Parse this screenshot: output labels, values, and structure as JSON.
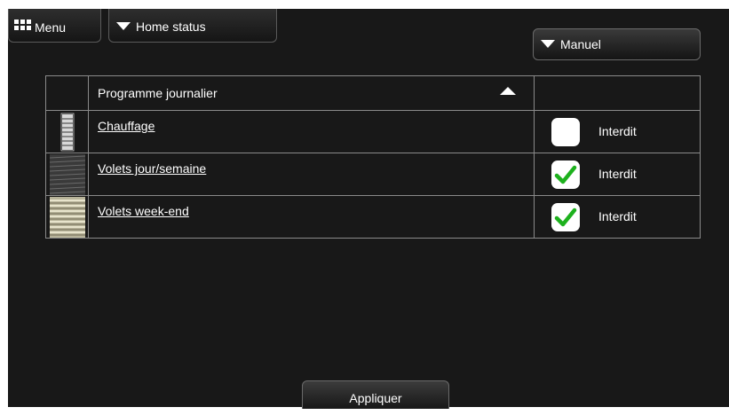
{
  "header": {
    "menu_label": "Menu",
    "home_status_label": "Home status",
    "mode_label": "Manuel"
  },
  "table": {
    "column_header": "Programme journalier",
    "rows": [
      {
        "name": "Chauffage",
        "icon": "radiator-icon",
        "state_label": "Interdit",
        "checked": false
      },
      {
        "name": "Volets jour/semaine",
        "icon": "blinds-dark-icon",
        "state_label": "Interdit",
        "checked": true
      },
      {
        "name": "Volets week-end",
        "icon": "blinds-light-icon",
        "state_label": "Interdit",
        "checked": true
      }
    ]
  },
  "footer": {
    "apply_label": "Appliquer"
  },
  "colors": {
    "check_green": "#1db11d",
    "background": "#181818"
  }
}
